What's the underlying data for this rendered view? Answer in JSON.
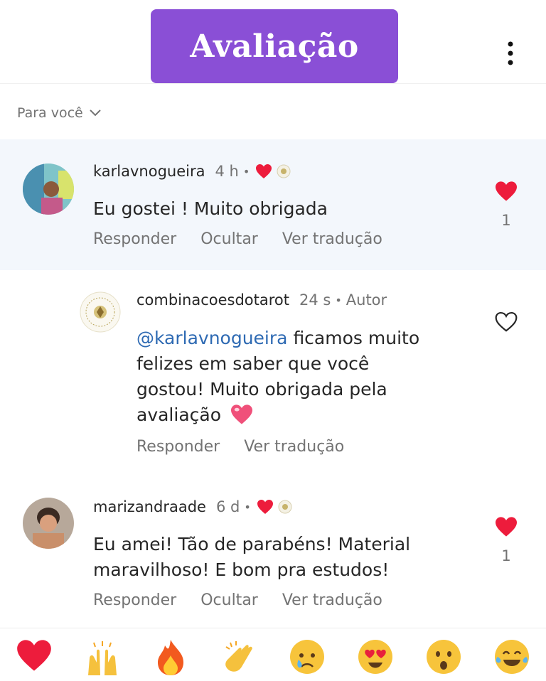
{
  "header": {
    "title": "Avaliação"
  },
  "filter": {
    "label": "Para você"
  },
  "comments": [
    {
      "username": "karlavnogueira",
      "time": "4 h",
      "text": "Eu gostei ! Muito obrigada",
      "actions": [
        "Responder",
        "Ocultar",
        "Ver tradução"
      ],
      "likes": "1"
    },
    {
      "username": "combinacoesdotarot",
      "time": "24 s",
      "author_label": "Autor",
      "mention": "@karlavnogueira",
      "text_lines": [
        "ficamos muito",
        "felizes em saber que você",
        "gostou! Muito obrigada pela",
        "avaliação"
      ],
      "actions": [
        "Responder",
        "Ver tradução"
      ]
    },
    {
      "username": "marizandraade",
      "time": "6 d",
      "text_lines": [
        "Eu amei! Tão de parabéns! Material",
        "maravilhoso! E bom pra estudos!"
      ],
      "actions": [
        "Responder",
        "Ocultar",
        "Ver tradução"
      ],
      "likes": "1"
    }
  ],
  "reaction_bar": [
    "heart",
    "raised-hands",
    "fire",
    "clapping-hands",
    "crying-face",
    "heart-eyes-face",
    "surprised-face",
    "tears-of-joy-face"
  ],
  "colors": {
    "badge": "#8a4fd6",
    "heart": "#ed1c3c",
    "mention": "#2e6ab3"
  }
}
